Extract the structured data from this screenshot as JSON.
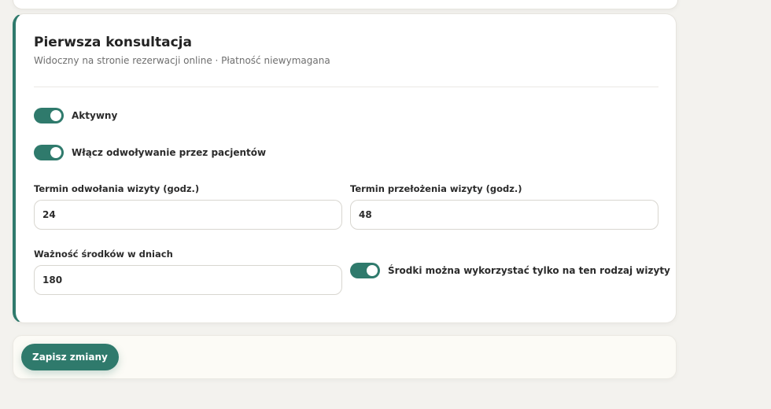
{
  "card": {
    "title": "Pierwsza konsultacja",
    "subtitle": "Widoczny na stronie rezerwacji online · Płatność niewymagana"
  },
  "toggles": {
    "active": {
      "label": "Aktywny",
      "on": true
    },
    "patient_cancellation": {
      "label": "Włącz odwoływanie przez pacjentów",
      "on": true
    },
    "funds_only_this_type": {
      "label": "Środki można wykorzystać tylko na ten rodzaj wizyty",
      "on": true
    }
  },
  "fields": {
    "cancellation_deadline": {
      "label": "Termin odwołania wizyty (godz.)",
      "value": "24"
    },
    "reschedule_deadline": {
      "label": "Termin przełożenia wizyty (godz.)",
      "value": "48"
    },
    "funds_validity": {
      "label": "Ważność środków w dniach",
      "value": "180"
    }
  },
  "footer": {
    "save_label": "Zapisz zmiany"
  },
  "colors": {
    "accent": "#2f7a6c",
    "background": "#f3f2ee",
    "card": "#ffffff"
  }
}
